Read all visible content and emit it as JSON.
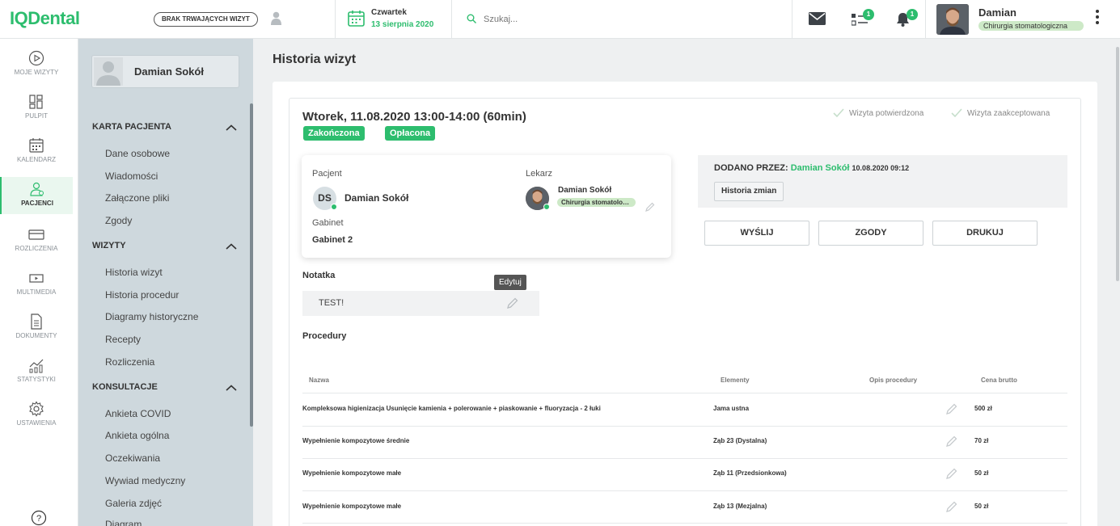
{
  "topbar": {
    "logo": "IQDental",
    "no_visit_label": "BRAK TRWAJĄCYCH WIZYT",
    "date_day": "Czwartek",
    "date_full": "13 sierpnia 2020",
    "search_placeholder": "Szukaj...",
    "tasks_badge": "1",
    "notif_badge": "1",
    "user_name": "Damian",
    "user_role": "Chirurgia stomatologiczna",
    "accent_color": "#2dbd6e"
  },
  "nav": [
    {
      "label": "MOJE WIZYTY",
      "icon": "play-circle-icon"
    },
    {
      "label": "PULPIT",
      "icon": "dashboard-icon"
    },
    {
      "label": "KALENDARZ",
      "icon": "calendar-icon"
    },
    {
      "label": "PACJENCI",
      "icon": "patients-icon"
    },
    {
      "label": "ROZLICZENIA",
      "icon": "card-icon"
    },
    {
      "label": "MULTIMEDIA",
      "icon": "media-icon"
    },
    {
      "label": "DOKUMENTY",
      "icon": "document-icon"
    },
    {
      "label": "STATYSTYKI",
      "icon": "stats-icon"
    },
    {
      "label": "USTAWIENIA",
      "icon": "gear-icon"
    }
  ],
  "patient": {
    "name": "Damian Sokół"
  },
  "sections": {
    "karta": {
      "title": "KARTA PACJENTA",
      "items": [
        "Dane osobowe",
        "Wiadomości",
        "Załączone pliki",
        "Zgody"
      ]
    },
    "wizyty": {
      "title": "WIZYTY",
      "items": [
        "Historia wizyt",
        "Historia procedur",
        "Diagramy historyczne",
        "Recepty",
        "Rozliczenia"
      ]
    },
    "konsultacje": {
      "title": "KONSULTACJE",
      "items": [
        "Ankieta COVID",
        "Ankieta ogólna",
        "Oczekiwania",
        "Wywiad medyczny",
        "Galeria zdjęć",
        "Diagram"
      ]
    }
  },
  "main": {
    "title": "Historia wizyt",
    "visit_title": "Wtorek, 11.08.2020 13:00-14:00 (60min)",
    "tag_finished": "Zakończona",
    "tag_paid": "Opłacona",
    "confirmed": "Wizyta potwierdzona",
    "accepted": "Wizyta zaakceptowana",
    "patient_label": "Pacjent",
    "patient_initials": "DS",
    "patient_name": "Damian Sokół",
    "doctor_label": "Lekarz",
    "doctor_name": "Damian Sokół",
    "doctor_role": "Chirurgia stomatologiczna",
    "room_label": "Gabinet",
    "room_value": "Gabinet 2",
    "added_by_label": "DODANO PRZEZ:",
    "added_by_name": "Damian Sokół",
    "added_date": "10.08.2020 09:12",
    "history_btn": "Historia zmian",
    "btn_send": "WYŚLIJ",
    "btn_consents": "ZGODY",
    "btn_print": "DRUKUJ",
    "note_title": "Notatka",
    "note_text": "TEST!",
    "tooltip": "Edytuj",
    "procedures_title": "Procedury"
  },
  "table": {
    "headers": {
      "name": "Nazwa",
      "elements": "Elementy",
      "desc": "Opis procedury",
      "price": "Cena brutto"
    },
    "rows": [
      {
        "name": "Kompleksowa higienizacja Usunięcie kamienia + polerowanie + piaskowanie + fluoryzacja - 2 łuki",
        "elements": "Jama ustna",
        "price": "500 zł"
      },
      {
        "name": "Wypełnienie kompozytowe średnie",
        "elements": "Ząb 23 (Dystalna)",
        "price": "70 zł"
      },
      {
        "name": "Wypełnienie kompozytowe małe",
        "elements": "Ząb 11 (Przedsionkowa)",
        "price": "50 zł"
      },
      {
        "name": "Wypełnienie kompozytowe małe",
        "elements": "Ząb 13 (Mezjalna)",
        "price": "50 zł"
      }
    ]
  }
}
